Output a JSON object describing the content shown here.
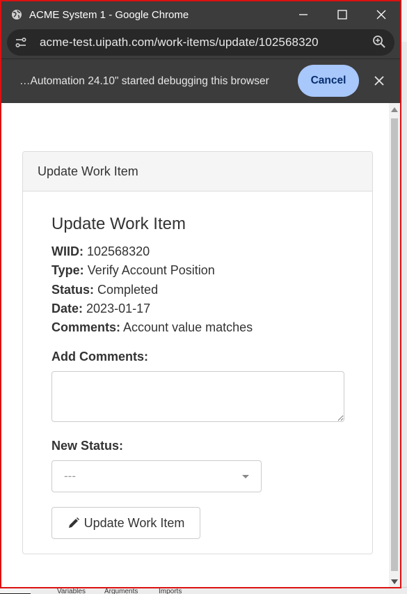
{
  "window": {
    "title": "ACME System 1 - Google Chrome"
  },
  "address": {
    "url": "acme-test.uipath.com/work-items/update/102568320"
  },
  "infobar": {
    "message": "…Automation 24.10\" started debugging this browser",
    "cancel_label": "Cancel"
  },
  "panel": {
    "header": "Update Work Item",
    "heading": "Update Work Item",
    "fields": [
      {
        "key": "WIID:",
        "value": "102568320"
      },
      {
        "key": "Type:",
        "value": "Verify Account Position"
      },
      {
        "key": "Status:",
        "value": "Completed"
      },
      {
        "key": "Date:",
        "value": "2023-01-17"
      },
      {
        "key": "Comments:",
        "value": "Account value matches"
      }
    ],
    "add_comments_label": "Add Comments:",
    "add_comments_value": "",
    "new_status_label": "New Status:",
    "new_status_selected": "---",
    "submit_label": "Update Work Item"
  },
  "background": {
    "tabs": [
      "Variables",
      "Arguments",
      "Imports"
    ]
  },
  "colors": {
    "chrome_dark": "#3c3c3c",
    "cancel_button": "#a8c7fa",
    "window_border": "#dd1111"
  }
}
